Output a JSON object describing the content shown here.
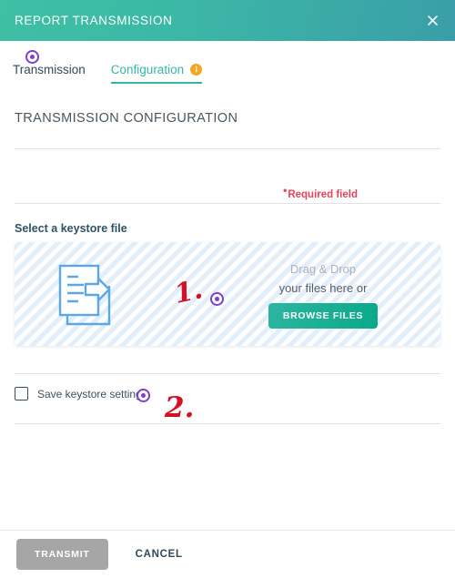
{
  "dialog": {
    "title": "REPORT TRANSMISSION",
    "close_icon": "close-icon"
  },
  "tabs": [
    {
      "label": "Transmission",
      "active": false,
      "badge": null
    },
    {
      "label": "Configuration",
      "active": true,
      "badge": "i"
    }
  ],
  "content": {
    "section_title": "TRANSMISSION CONFIGURATION",
    "required_marker": "•",
    "required_note": "Required field",
    "field_label": "Select a keystore file"
  },
  "dropzone": {
    "icon": "document-export-icon",
    "line1": "Drag & Drop",
    "line2": "your files here or",
    "browse_label": "BROWSE FILES"
  },
  "checkbox_row": {
    "label": "Save keystore settings",
    "checked": false
  },
  "footer": {
    "transmit_label": "TRANSMIT",
    "transmit_disabled": true,
    "cancel_label": "CANCEL"
  },
  "annotations": {
    "step1": "1.",
    "step2": "2.",
    "marker_color": "#7b3fd4",
    "number_color": "#d60f24"
  },
  "colors": {
    "header_gradient_start": "#3fbfa4",
    "header_gradient_end": "#3a9ea8",
    "accent_teal": "#35b6a4",
    "badge_orange": "#f5a623",
    "required_red": "#e8425a",
    "disabled_gray": "#a6a6a6"
  }
}
